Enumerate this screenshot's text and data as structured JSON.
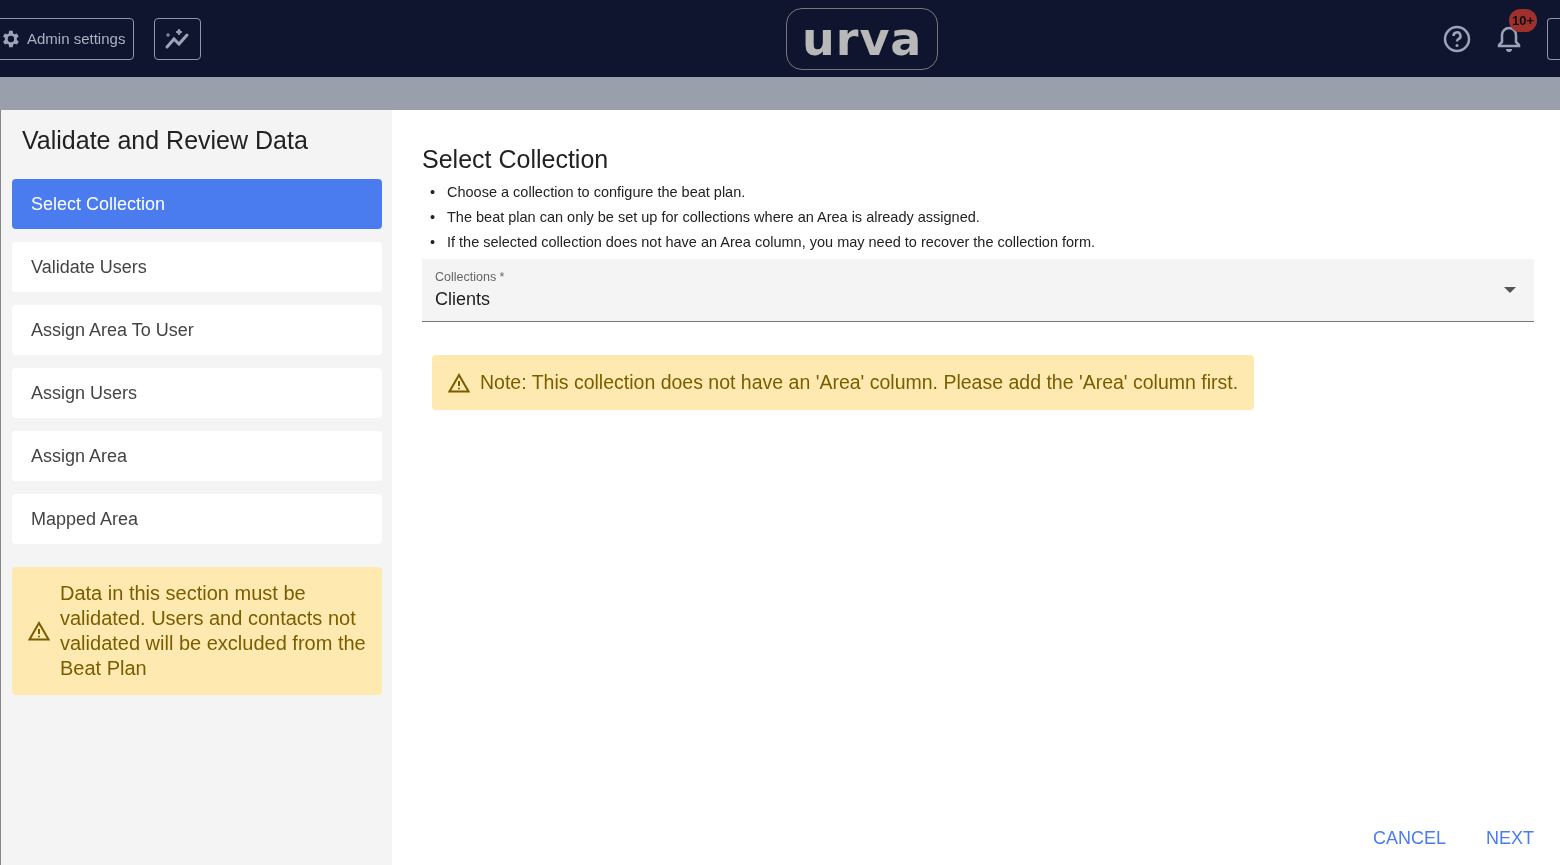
{
  "header": {
    "admin_button": "Admin settings",
    "logo": "urva",
    "notification_badge": "10+"
  },
  "dialog": {
    "title": "Validate and Review Data",
    "steps": [
      {
        "label": "Select Collection",
        "selected": true
      },
      {
        "label": "Validate Users",
        "selected": false
      },
      {
        "label": "Assign Area To User",
        "selected": false
      },
      {
        "label": "Assign Users",
        "selected": false
      },
      {
        "label": "Assign Area",
        "selected": false
      },
      {
        "label": "Mapped Area",
        "selected": false
      }
    ],
    "side_warning": "Data in this section must be validated. Users and contacts not validated will be excluded from the Beat Plan",
    "heading": "Select Collection",
    "instructions": [
      {
        "bullet": "•",
        "text": "Choose a collection to configure the beat plan."
      },
      {
        "bullet": "•",
        "text": "The beat plan can only be set up for collections where an Area is already assigned."
      },
      {
        "bullet": "•",
        "text": "If the selected collection does not have an Area column, you may need to recover the collection form."
      }
    ],
    "collections_field": {
      "label": "Collections *",
      "value": "Clients"
    },
    "note": "Note: This collection does not have an 'Area' column. Please add the 'Area' column first.",
    "buttons": [
      "CANCEL",
      "NEXT"
    ]
  }
}
